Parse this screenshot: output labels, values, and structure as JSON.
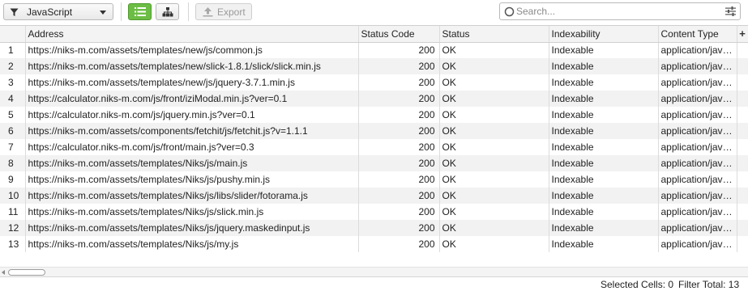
{
  "toolbar": {
    "filter_label": "JavaScript",
    "export_label": "Export"
  },
  "search": {
    "placeholder": "Search..."
  },
  "colors": {
    "accent_green": "#6cbd45",
    "row_alt": "#f2f2f2",
    "header_bg": "#f3f3f3"
  },
  "icons": {
    "filter": "funnel-icon",
    "list_view": "list-view-icon",
    "tree_view": "tree-view-icon",
    "export": "export-icon",
    "search": "search-icon",
    "advanced_search": "sliders-icon",
    "add_column": "plus-icon"
  },
  "table": {
    "columns": [
      "",
      "Address",
      "Status Code",
      "Status",
      "Indexability",
      "Content Type",
      "+"
    ],
    "rows": [
      {
        "num": "1",
        "address": "https://niks-m.com/assets/templates/new/js/common.js",
        "code": "200",
        "status": "OK",
        "indexability": "Indexable",
        "content_type": "application/java..."
      },
      {
        "num": "2",
        "address": "https://niks-m.com/assets/templates/new/slick-1.8.1/slick/slick.min.js",
        "code": "200",
        "status": "OK",
        "indexability": "Indexable",
        "content_type": "application/java..."
      },
      {
        "num": "3",
        "address": "https://niks-m.com/assets/templates/new/js/jquery-3.7.1.min.js",
        "code": "200",
        "status": "OK",
        "indexability": "Indexable",
        "content_type": "application/java..."
      },
      {
        "num": "4",
        "address": "https://calculator.niks-m.com/js/front/iziModal.min.js?ver=0.1",
        "code": "200",
        "status": "OK",
        "indexability": "Indexable",
        "content_type": "application/java..."
      },
      {
        "num": "5",
        "address": "https://calculator.niks-m.com/js/jquery.min.js?ver=0.1",
        "code": "200",
        "status": "OK",
        "indexability": "Indexable",
        "content_type": "application/java..."
      },
      {
        "num": "6",
        "address": "https://niks-m.com/assets/components/fetchit/js/fetchit.js?v=1.1.1",
        "code": "200",
        "status": "OK",
        "indexability": "Indexable",
        "content_type": "application/java..."
      },
      {
        "num": "7",
        "address": "https://calculator.niks-m.com/js/front/main.js?ver=0.3",
        "code": "200",
        "status": "OK",
        "indexability": "Indexable",
        "content_type": "application/java..."
      },
      {
        "num": "8",
        "address": "https://niks-m.com/assets/templates/Niks/js/main.js",
        "code": "200",
        "status": "OK",
        "indexability": "Indexable",
        "content_type": "application/java..."
      },
      {
        "num": "9",
        "address": "https://niks-m.com/assets/templates/Niks/js/pushy.min.js",
        "code": "200",
        "status": "OK",
        "indexability": "Indexable",
        "content_type": "application/java..."
      },
      {
        "num": "10",
        "address": "https://niks-m.com/assets/templates/Niks/js/libs/slider/fotorama.js",
        "code": "200",
        "status": "OK",
        "indexability": "Indexable",
        "content_type": "application/java..."
      },
      {
        "num": "11",
        "address": "https://niks-m.com/assets/templates/Niks/js/slick.min.js",
        "code": "200",
        "status": "OK",
        "indexability": "Indexable",
        "content_type": "application/java..."
      },
      {
        "num": "12",
        "address": "https://niks-m.com/assets/templates/Niks/js/jquery.maskedinput.js",
        "code": "200",
        "status": "OK",
        "indexability": "Indexable",
        "content_type": "application/java..."
      },
      {
        "num": "13",
        "address": "https://niks-m.com/assets/templates/Niks/js/my.js",
        "code": "200",
        "status": "OK",
        "indexability": "Indexable",
        "content_type": "application/java..."
      }
    ]
  },
  "status_bar": {
    "selected_cells": "Selected Cells:  0",
    "filter_total": "Filter Total:  13"
  }
}
